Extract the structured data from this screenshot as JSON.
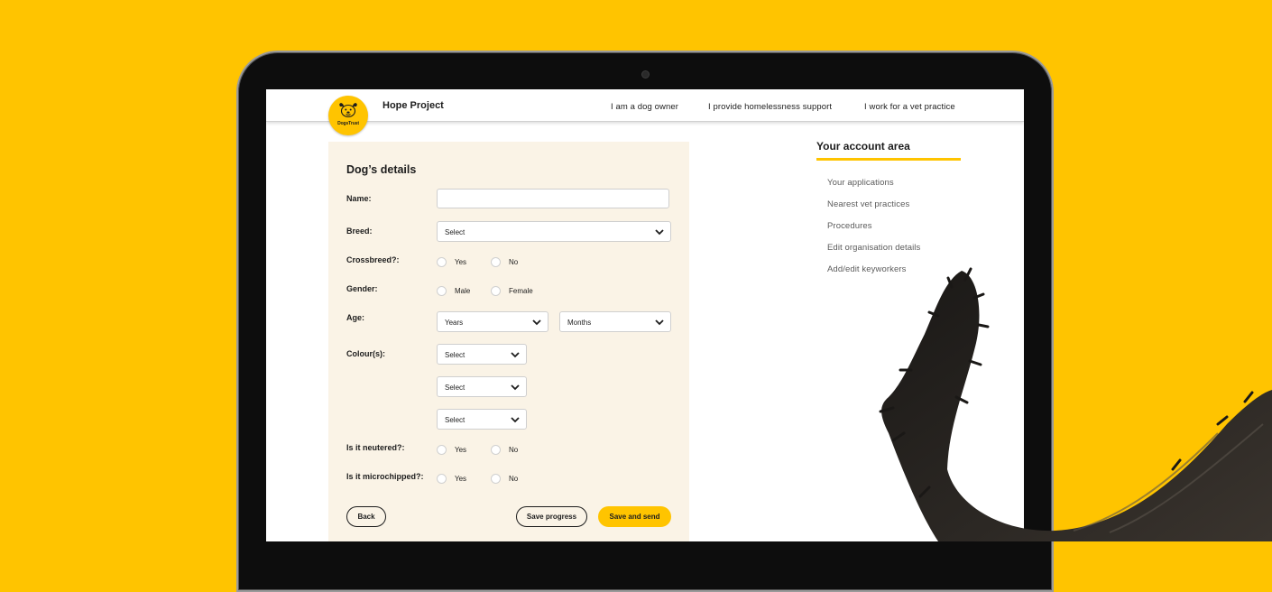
{
  "header": {
    "logo_text": "DogsTrust",
    "title": "Hope Project",
    "nav": [
      {
        "label": "I am a dog owner"
      },
      {
        "label": "I provide homelessness support"
      },
      {
        "label": "I work for a vet practice"
      }
    ]
  },
  "form": {
    "title": "Dog’s details",
    "name_label": "Name:",
    "name_value": "",
    "breed_label": "Breed:",
    "breed_value": "Select",
    "crossbreed_label": "Crossbreed?:",
    "gender_label": "Gender:",
    "age_label": "Age:",
    "age_years": "Years",
    "age_months": "Months",
    "colours_label": "Colour(s):",
    "colour_values": [
      "Select",
      "Select",
      "Select"
    ],
    "neutered_label": "Is it neutered?:",
    "microchipped_label": "Is it microchipped?:",
    "yes": "Yes",
    "no": "No",
    "male": "Male",
    "female": "Female",
    "back_label": "Back",
    "save_progress_label": "Save progress",
    "save_send_label": "Save and send"
  },
  "account": {
    "title": "Your account area",
    "items": [
      {
        "label": "Your applications"
      },
      {
        "label": "Nearest vet practices"
      },
      {
        "label": "Procedures"
      },
      {
        "label": "Edit organisation details"
      },
      {
        "label": "Add/edit keyworkers"
      }
    ]
  },
  "colors": {
    "background": "#ffc400",
    "accent": "#ffc400",
    "panel": "#faf3e6"
  }
}
